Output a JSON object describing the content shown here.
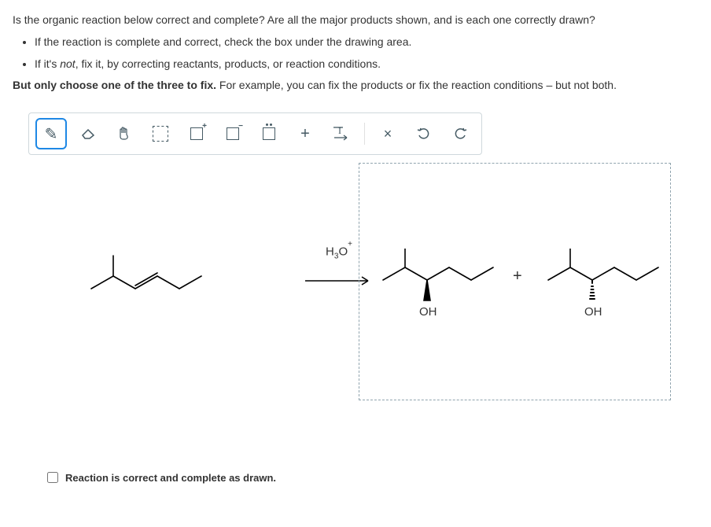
{
  "question": {
    "line1": "Is the organic reaction below correct and complete? Are all the major products shown, and is each one correctly drawn?",
    "bullet1": "If the reaction is complete and correct, check the box under the drawing area.",
    "bullet2_prefix": "If it's ",
    "bullet2_em": "not",
    "bullet2_suffix": ", fix it, by correcting reactants, products, or reaction conditions.",
    "line3_bold": "But only choose one of the three to fix.",
    "line3_rest": " For example, you can fix the products or fix the reaction conditions – but not both."
  },
  "toolbar": {
    "pencil": "✎",
    "eraser": "⌫",
    "hand": "✋",
    "plus": "+",
    "text": "I",
    "delete": "×",
    "undo": "↶",
    "redo": "↻"
  },
  "reaction": {
    "reagent": "H₃O⁺",
    "plus": "+",
    "oh": "OH"
  },
  "checkbox": {
    "label": "Reaction is correct and complete as drawn."
  }
}
